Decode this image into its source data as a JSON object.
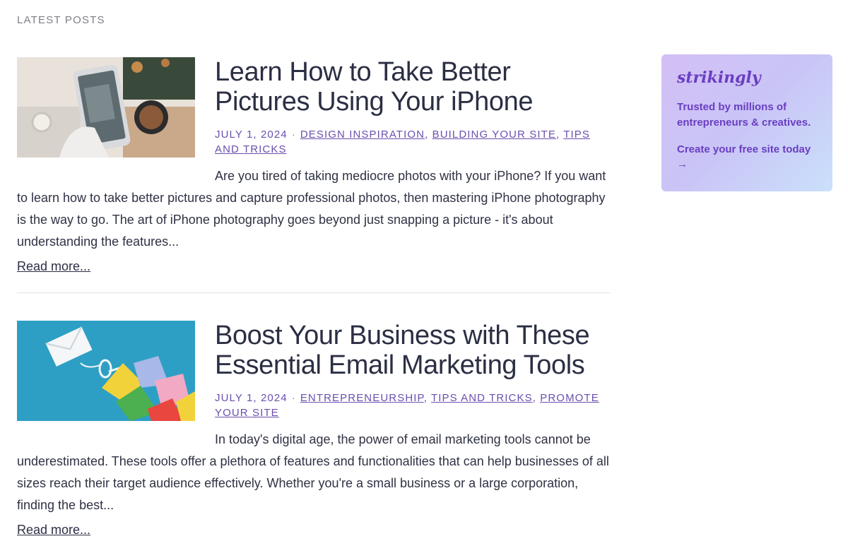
{
  "section_label": "LATEST POSTS",
  "posts": [
    {
      "title": "Learn How to Take Better Pictures Using Your iPhone",
      "date": "JULY 1, 2024",
      "separator": "·",
      "categories": [
        "DESIGN INSPIRATION",
        "BUILDING YOUR SITE",
        "TIPS AND TRICKS"
      ],
      "excerpt": "Are you tired of taking mediocre photos with your iPhone? If you want to learn how to take better pictures and capture professional photos, then mastering iPhone photography is the way to go. The art of iPhone photography goes beyond just snapping a picture - it's about understanding the features...",
      "read_more": "Read more..."
    },
    {
      "title": "Boost Your Business with These Essential Email Marketing Tools",
      "date": "JULY 1, 2024",
      "separator": "·",
      "categories": [
        "ENTREPRENEURSHIP",
        "TIPS AND TRICKS",
        "PROMOTE YOUR SITE"
      ],
      "excerpt": "In today's digital age, the power of email marketing tools cannot be underestimated. These tools offer a plethora of features and functionalities that can help businesses of all sizes reach their target audience effectively. Whether you're a small business or a large corporation, finding the best...",
      "read_more": "Read more..."
    }
  ],
  "promo": {
    "logo": "strikingly",
    "text": "Trusted by millions of entrepreneurs & creatives.",
    "cta": "Create your free site today →"
  },
  "colors": {
    "accent": "#6b4fae",
    "promo_text": "#6a3ec2"
  }
}
